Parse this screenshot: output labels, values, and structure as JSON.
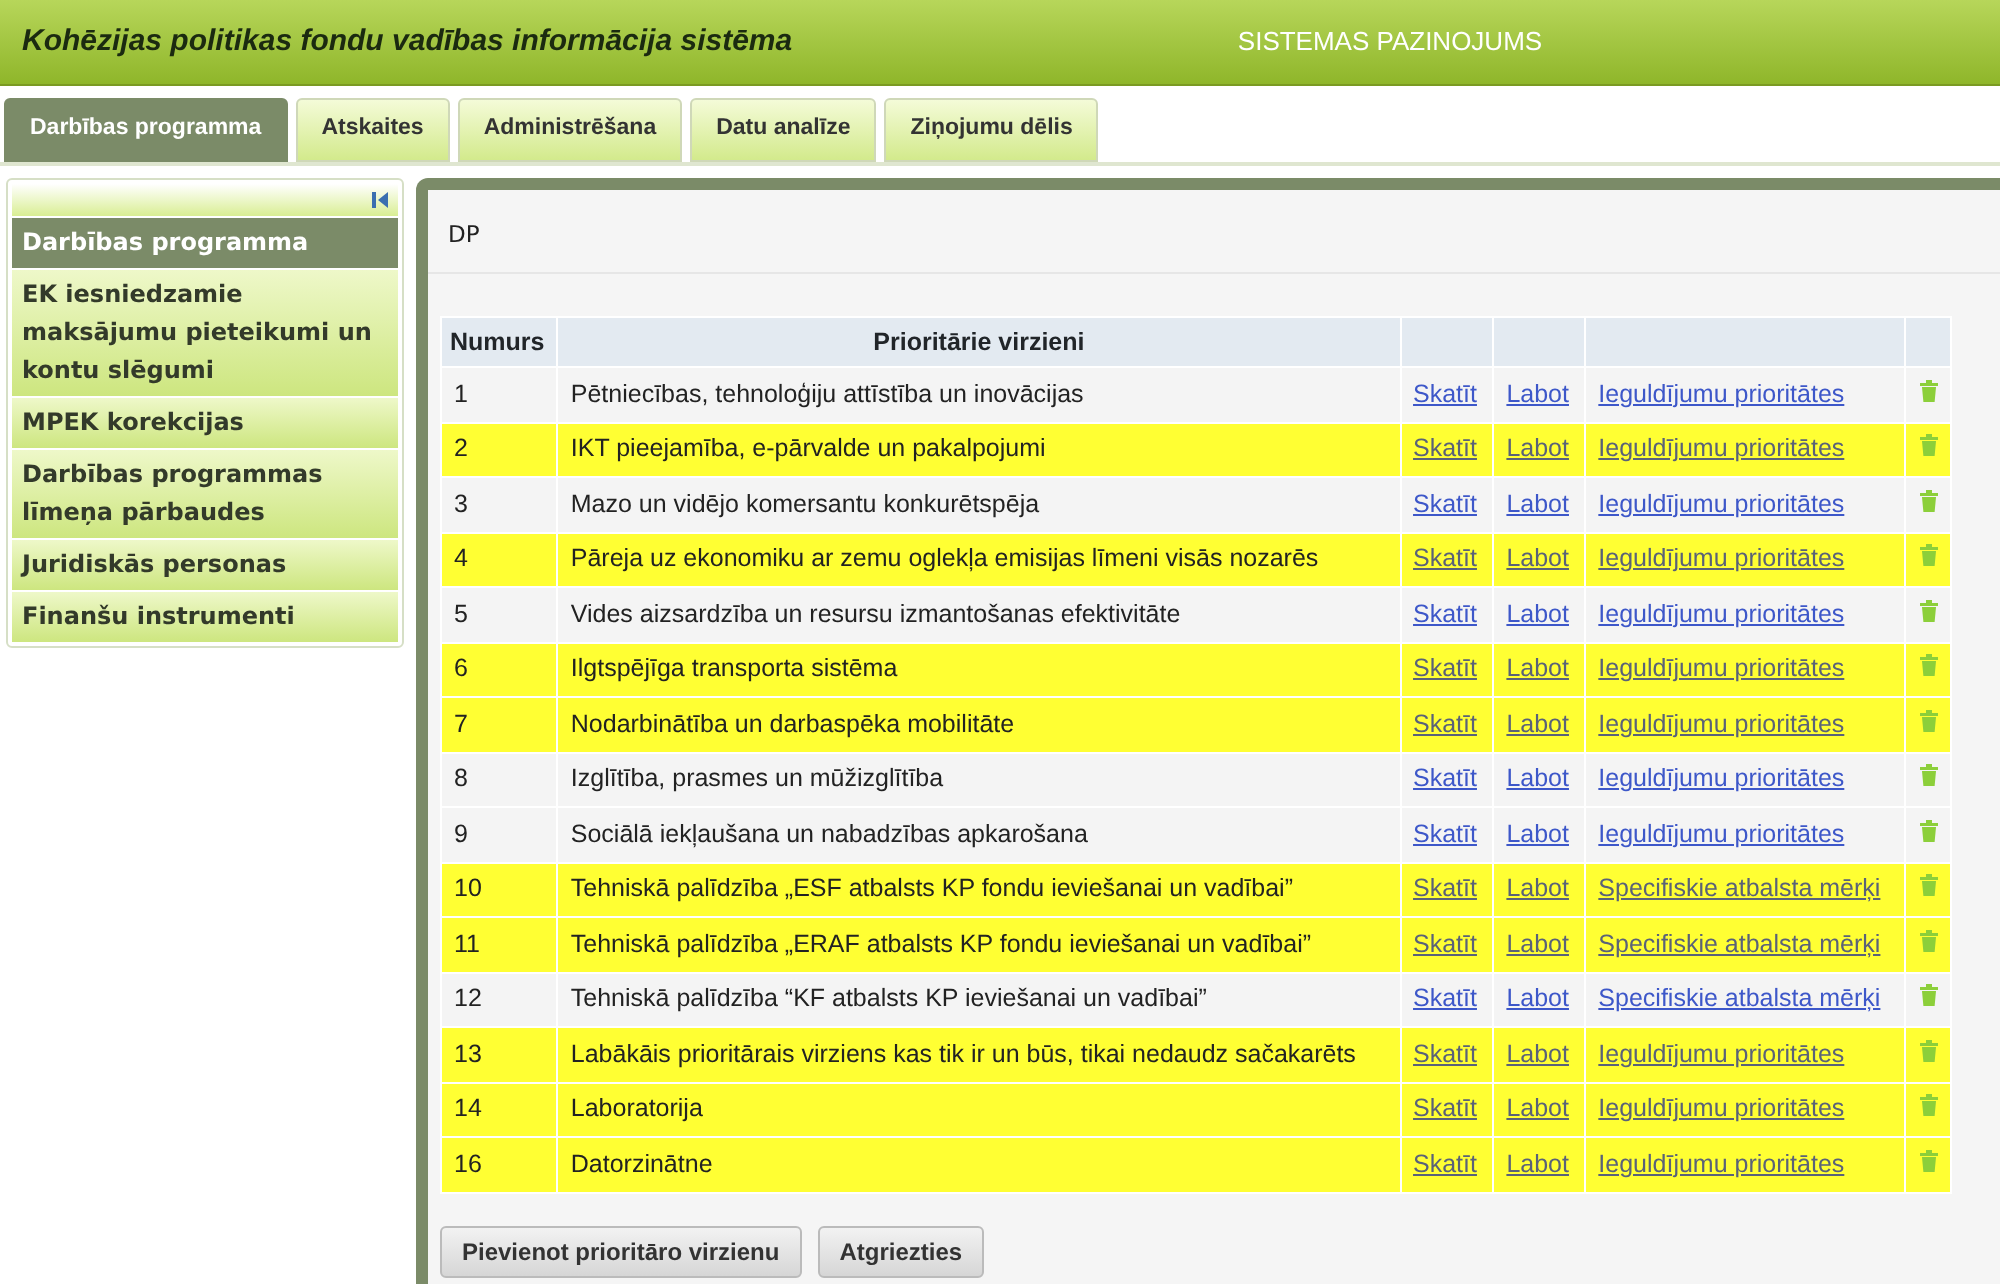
{
  "header": {
    "title": "Kohēzijas politikas fondu vadības informācija sistēma",
    "notice": "SISTEMAS PAZINOJUMS"
  },
  "tabs": [
    {
      "label": "Darbības programma",
      "selected": true
    },
    {
      "label": "Atskaites",
      "selected": false
    },
    {
      "label": "Administrēšana",
      "selected": false
    },
    {
      "label": "Datu analīze",
      "selected": false
    },
    {
      "label": "Ziņojumu dēlis",
      "selected": false
    }
  ],
  "sidebar": {
    "items": [
      {
        "label": "Darbības programma",
        "selected": true
      },
      {
        "label": "EK iesniedzamie maksājumu pieteikumi un kontu slēgumi",
        "selected": false
      },
      {
        "label": "MPEK korekcijas",
        "selected": false
      },
      {
        "label": "Darbības programmas līmeņa pārbaudes",
        "selected": false
      },
      {
        "label": "Juridiskās personas",
        "selected": false
      },
      {
        "label": "Finanšu instrumenti",
        "selected": false
      }
    ]
  },
  "breadcrumb": "DP",
  "table": {
    "columns": [
      "Numurs",
      "Prioritārie virzieni"
    ],
    "rows": [
      {
        "number": "1",
        "name": "Pētniecības, tehnoloģiju attīstība un inovācijas",
        "view": "Skatīt",
        "edit": "Labot",
        "link": "Ieguldījumu prioritātes",
        "highlighted": false
      },
      {
        "number": "2",
        "name": "IKT pieejamība, e-pārvalde un pakalpojumi",
        "view": "Skatīt",
        "edit": "Labot",
        "link": "Ieguldījumu prioritātes",
        "highlighted": true
      },
      {
        "number": "3",
        "name": "Mazo un vidējo komersantu konkurētspēja",
        "view": "Skatīt",
        "edit": "Labot",
        "link": "Ieguldījumu prioritātes",
        "highlighted": false
      },
      {
        "number": "4",
        "name": "Pāreja uz ekonomiku ar zemu oglekļa emisijas līmeni visās nozarēs",
        "view": "Skatīt",
        "edit": "Labot",
        "link": "Ieguldījumu prioritātes",
        "highlighted": true
      },
      {
        "number": "5",
        "name": "Vides aizsardzība un resursu izmantošanas efektivitāte",
        "view": "Skatīt",
        "edit": "Labot",
        "link": "Ieguldījumu prioritātes",
        "highlighted": false
      },
      {
        "number": "6",
        "name": "Ilgtspējīga transporta sistēma",
        "view": "Skatīt",
        "edit": "Labot",
        "link": "Ieguldījumu prioritātes",
        "highlighted": true
      },
      {
        "number": "7",
        "name": "Nodarbinātība un darbaspēka mobilitāte",
        "view": "Skatīt",
        "edit": "Labot",
        "link": "Ieguldījumu prioritātes",
        "highlighted": true
      },
      {
        "number": "8",
        "name": "Izglītība, prasmes un mūžizglītība",
        "view": "Skatīt",
        "edit": "Labot",
        "link": "Ieguldījumu prioritātes",
        "highlighted": false
      },
      {
        "number": "9",
        "name": "Sociālā iekļaušana un nabadzības apkarošana",
        "view": "Skatīt",
        "edit": "Labot",
        "link": "Ieguldījumu prioritātes",
        "highlighted": false
      },
      {
        "number": "10",
        "name": "Tehniskā palīdzība „ESF atbalsts KP fondu ieviešanai un vadībai”",
        "view": "Skatīt",
        "edit": "Labot",
        "link": "Specifiskie atbalsta mērķi",
        "highlighted": true
      },
      {
        "number": "11",
        "name": "Tehniskā palīdzība „ERAF atbalsts KP fondu ieviešanai un vadībai”",
        "view": "Skatīt",
        "edit": "Labot",
        "link": "Specifiskie atbalsta mērķi",
        "highlighted": true
      },
      {
        "number": "12",
        "name": "Tehniskā palīdzība “KF atbalsts KP ieviešanai un vadībai”",
        "view": "Skatīt",
        "edit": "Labot",
        "link": "Specifiskie atbalsta mērķi",
        "highlighted": false
      },
      {
        "number": "13",
        "name": "Labākāis prioritārais virziens kas tik ir un būs, tikai nedaudz sačakarēts",
        "view": "Skatīt",
        "edit": "Labot",
        "link": "Ieguldījumu prioritātes",
        "highlighted": true
      },
      {
        "number": "14",
        "name": "Laboratorija",
        "view": "Skatīt",
        "edit": "Labot",
        "link": "Ieguldījumu prioritātes",
        "highlighted": true
      },
      {
        "number": "16",
        "name": "Datorzinātne",
        "view": "Skatīt",
        "edit": "Labot",
        "link": "Ieguldījumu prioritātes",
        "highlighted": true
      }
    ]
  },
  "buttons": [
    "Pievienot prioritāro virzienu",
    "Atgriezties"
  ]
}
